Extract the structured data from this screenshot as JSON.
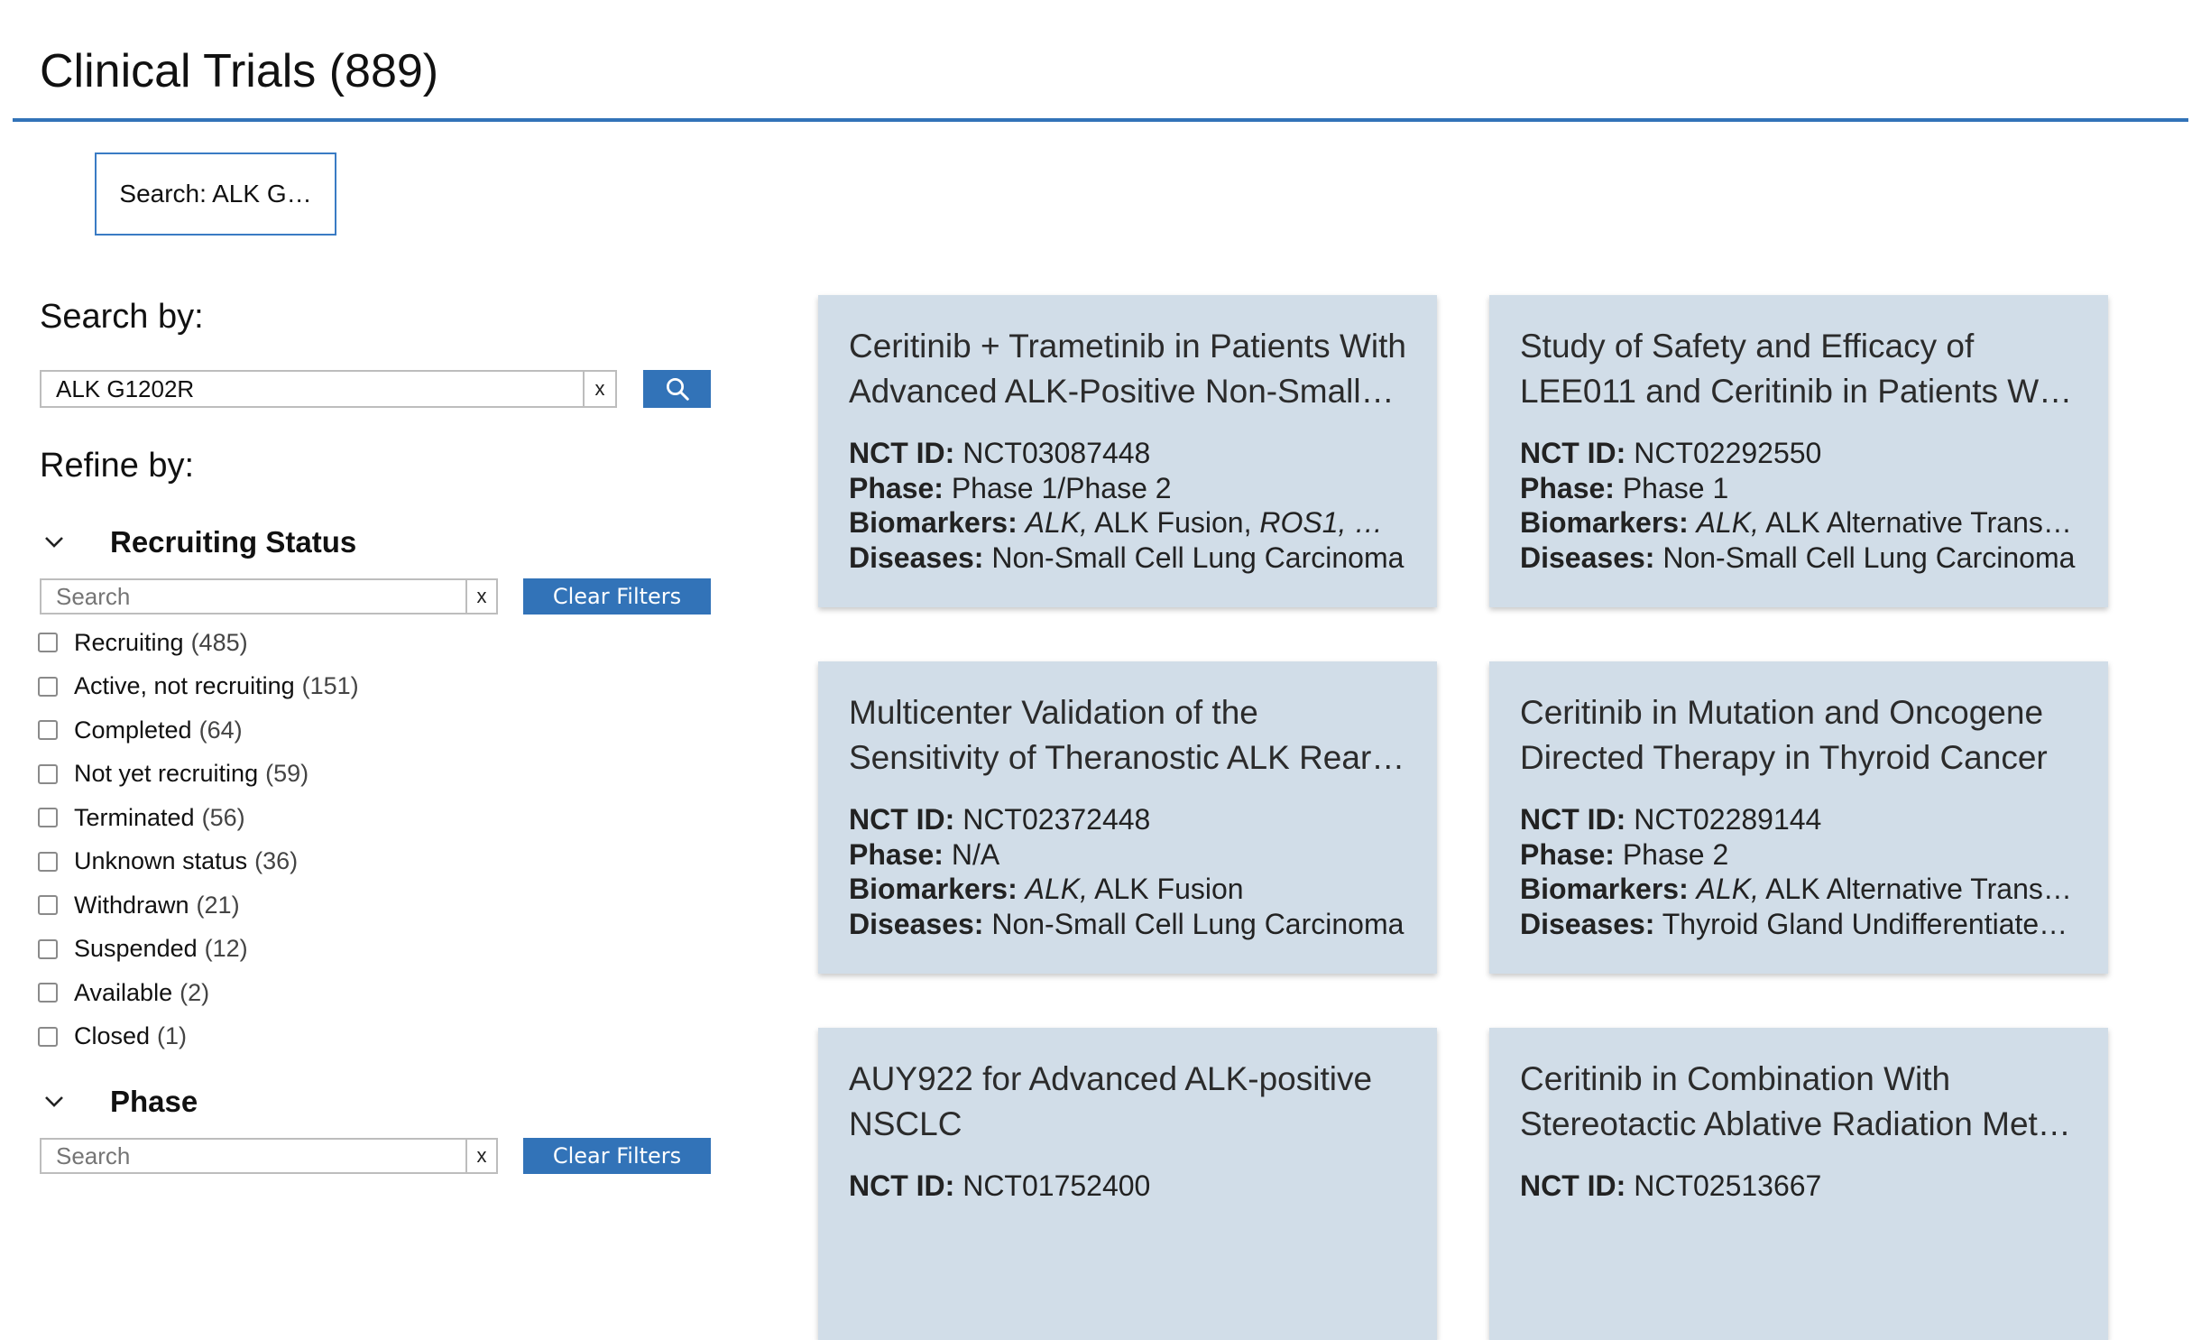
{
  "page": {
    "title": "Clinical Trials (889)"
  },
  "search_chip": {
    "label": "Search: ALK G…"
  },
  "search": {
    "heading": "Search by:",
    "value": "ALK G1202R",
    "clear_label": "x"
  },
  "refine": {
    "heading": "Refine by:"
  },
  "facets": [
    {
      "name": "Recruiting Status",
      "search_placeholder": "Search",
      "clear_x": "x",
      "clear_filters_label": "Clear Filters",
      "options": [
        {
          "label": "Recruiting",
          "count": "(485)"
        },
        {
          "label": "Active, not recruiting",
          "count": "(151)"
        },
        {
          "label": "Completed",
          "count": "(64)"
        },
        {
          "label": "Not yet recruiting",
          "count": "(59)"
        },
        {
          "label": "Terminated",
          "count": "(56)"
        },
        {
          "label": "Unknown status",
          "count": "(36)"
        },
        {
          "label": "Withdrawn",
          "count": "(21)"
        },
        {
          "label": "Suspended",
          "count": "(12)"
        },
        {
          "label": "Available",
          "count": "(2)"
        },
        {
          "label": "Closed",
          "count": "(1)"
        }
      ]
    },
    {
      "name": "Phase",
      "search_placeholder": "Search",
      "clear_x": "x",
      "clear_filters_label": "Clear Filters"
    }
  ],
  "field_labels": {
    "nct": "NCT ID:",
    "phase": "Phase:",
    "biomarkers": "Biomarkers:",
    "diseases": "Diseases:"
  },
  "trials": [
    {
      "title": "Ceritinib + Trametinib in Patients With Advanced ALK-Positive Non-Small…",
      "nct": "NCT03087448",
      "phase": "Phase 1/Phase 2",
      "bio_a": "ALK,",
      "bio_b": "ALK Fusion,",
      "bio_c": "ROS1, …",
      "diseases": "Non-Small Cell Lung Carcinoma"
    },
    {
      "title": "Study of Safety and Efficacy of LEE011 and Ceritinib in Patients W…",
      "nct": "NCT02292550",
      "phase": "Phase 1",
      "bio_a": "ALK,",
      "bio_b": "ALK Alternative Trans…",
      "bio_c": "",
      "diseases": "Non-Small Cell Lung Carcinoma"
    },
    {
      "title": "Multicenter Validation of the Sensitivity of Theranostic ALK Rear…",
      "nct": "NCT02372448",
      "phase": "N/A",
      "bio_a": "ALK,",
      "bio_b": "ALK Fusion",
      "bio_c": "",
      "diseases": "Non-Small Cell Lung Carcinoma"
    },
    {
      "title": "Ceritinib in Mutation and Oncogene Directed Therapy in Thyroid Cancer",
      "nct": "NCT02289144",
      "phase": "Phase 2",
      "bio_a": "ALK,",
      "bio_b": "ALK Alternative Trans…",
      "bio_c": "",
      "diseases": "Thyroid Gland Undifferentiate…"
    },
    {
      "title": "AUY922 for Advanced ALK-positive NSCLC",
      "nct": "NCT01752400"
    },
    {
      "title": "Ceritinib in Combination With Stereotactic Ablative Radiation Met…",
      "nct": "NCT02513667"
    }
  ],
  "colors": {
    "accent": "#3273b8",
    "card_bg": "#d1dde8",
    "border": "#bdbdbd"
  },
  "icons": {
    "search_button": "magnifier-icon",
    "facet_toggle": "chevron-down-icon"
  }
}
